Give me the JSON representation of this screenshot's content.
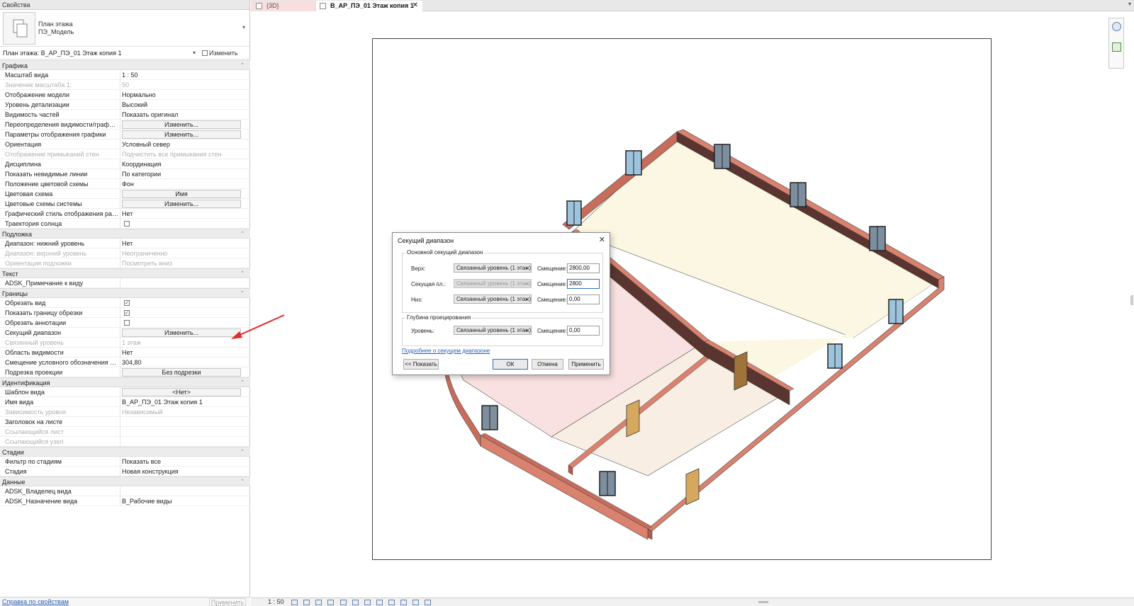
{
  "properties": {
    "title": "Свойства",
    "type_name_1": "План этажа",
    "type_name_2": "ПЭ_Модель",
    "instance_label": "План этажа: В_АР_ПЭ_01 Этаж копия 1",
    "edit_type": "Изменить тип",
    "groups": {
      "graphics": "Графика",
      "underlay": "Подложка",
      "text": "Текст",
      "extents": "Границы",
      "identity": "Идентификация",
      "phasing": "Стадии",
      "data": "Данные"
    },
    "rows": {
      "view_scale_k": "Масштаб вида",
      "view_scale_v": "1 : 50",
      "scale_value_k": "Значение масштаба    1:",
      "scale_value_v": "50",
      "display_model_k": "Отображение модели",
      "display_model_v": "Нормально",
      "detail_level_k": "Уровень детализации",
      "detail_level_v": "Высокий",
      "parts_vis_k": "Видимость частей",
      "parts_vis_v": "Показать оригинал",
      "vg_overrides_k": "Переопределения видимости/графики",
      "vg_overrides_v": "Изменить...",
      "graphic_display_k": "Параметры отображения графики",
      "graphic_display_v": "Изменить...",
      "orientation_k": "Ориентация",
      "orientation_v": "Условный север",
      "wall_join_k": "Отображение примыканий стен",
      "wall_join_v": "Подчистить все примыкания стен",
      "discipline_k": "Дисциплина",
      "discipline_v": "Координация",
      "hidden_lines_k": "Показать невидимые линии",
      "hidden_lines_v": "По категории",
      "color_loc_k": "Положение цветовой схемы",
      "color_loc_v": "Фон",
      "color_scheme_k": "Цветовая схема",
      "color_scheme_v": "Имя",
      "system_colors_k": "Цветовые схемы системы",
      "system_colors_v": "Изменить...",
      "analysis_style_k": "Графический стиль отображения расчет...",
      "analysis_style_v": "Нет",
      "sun_path_k": "Траектория солнца",
      "range_base_k": "Диапазон: нижний уровень",
      "range_base_v": "Нет",
      "range_top_k": "Диапазон: верхний уровень",
      "range_top_v": "Неограниченно",
      "underlay_orient_k": "Ориентация подложки",
      "underlay_orient_v": "Посмотреть вниз",
      "adsk_note_k": "ADSK_Примечание к виду",
      "crop_view_k": "Обрезать вид",
      "crop_visible_k": "Показать границу обрезки",
      "annot_crop_k": "Обрезать аннотации",
      "view_range_k": "Секущий диапазон",
      "view_range_v": "Изменить...",
      "assoc_level_k": "Связанный уровень",
      "assoc_level_v": "1 этаж",
      "scope_box_k": "Область видимости",
      "scope_box_v": "Нет",
      "depth_offset_k": "Смещение условного обозначения коло...",
      "depth_offset_v": "304,80",
      "depth_clip_k": "Подрезка проекции",
      "depth_clip_v": "Без подрезки",
      "template_k": "Шаблон вида",
      "template_v": "<Нет>",
      "view_name_k": "Имя вида",
      "view_name_v": "В_АР_ПЭ_01 Этаж копия 1",
      "dependency_k": "Зависимость уровня",
      "dependency_v": "Независимый",
      "title_sheet_k": "Заголовок на листе",
      "ref_sheet_k": "Ссылающийся лист",
      "ref_detail_k": "Ссылающийся узел",
      "phase_filter_k": "Фильтр по стадиям",
      "phase_filter_v": "Показать все",
      "phase_k": "Стадия",
      "phase_v": "Новая конструкция",
      "owner_k": "ADSK_Владелец вида",
      "purpose_k": "ADSK_Назначение вида",
      "purpose_v": "В_Рабочие виды"
    },
    "help_link": "Справка по свойствам",
    "apply": "Применить"
  },
  "tabs": {
    "tab_3d": "{3D}",
    "tab_plan": "В_АР_ПЭ_01 Этаж копия 1",
    "close": "✕",
    "menu": "▾"
  },
  "dialog": {
    "title": "Секущий диапазон",
    "close": "✕",
    "primary_group": "Основной секущий диапазон",
    "top_label": "Верх:",
    "top_combo": "Связанный уровень (1 этаж)",
    "top_offset_label": "Смещение:",
    "top_offset": "2800,00",
    "cut_label": "Секущая пл.:",
    "cut_combo": "Связанный уровень (1 этаж)",
    "cut_offset_label": "Смещение:",
    "cut_offset": "2800",
    "bottom_label": "Низ:",
    "bottom_combo": "Связанный уровень (1 этаж)",
    "bottom_offset_label": "Смещение:",
    "bottom_offset": "0,00",
    "depth_group": "Глубина проецирования",
    "level_label": "Уровень:",
    "level_combo": "Связанный уровень (1 этаж)",
    "level_offset_label": "Смещение:",
    "level_offset": "0,00",
    "more_link": "Подробнее о секущем диапазоне",
    "show_btn": "<< Показать",
    "ok_btn": "ОК",
    "cancel_btn": "Отмена",
    "apply_btn": "Применить"
  },
  "viewbar": {
    "scale": "1 : 50"
  },
  "colors": {
    "wall_face": "#d9826f",
    "wall_inner": "#5a3530",
    "floor_yellow": "#fbf7e3",
    "floor_pink": "#f9e1e1",
    "floor_beige": "#f8eee3",
    "door": "#d6a85e",
    "window_glass": "#9ec4dd",
    "arrow": "#e52a2a"
  }
}
